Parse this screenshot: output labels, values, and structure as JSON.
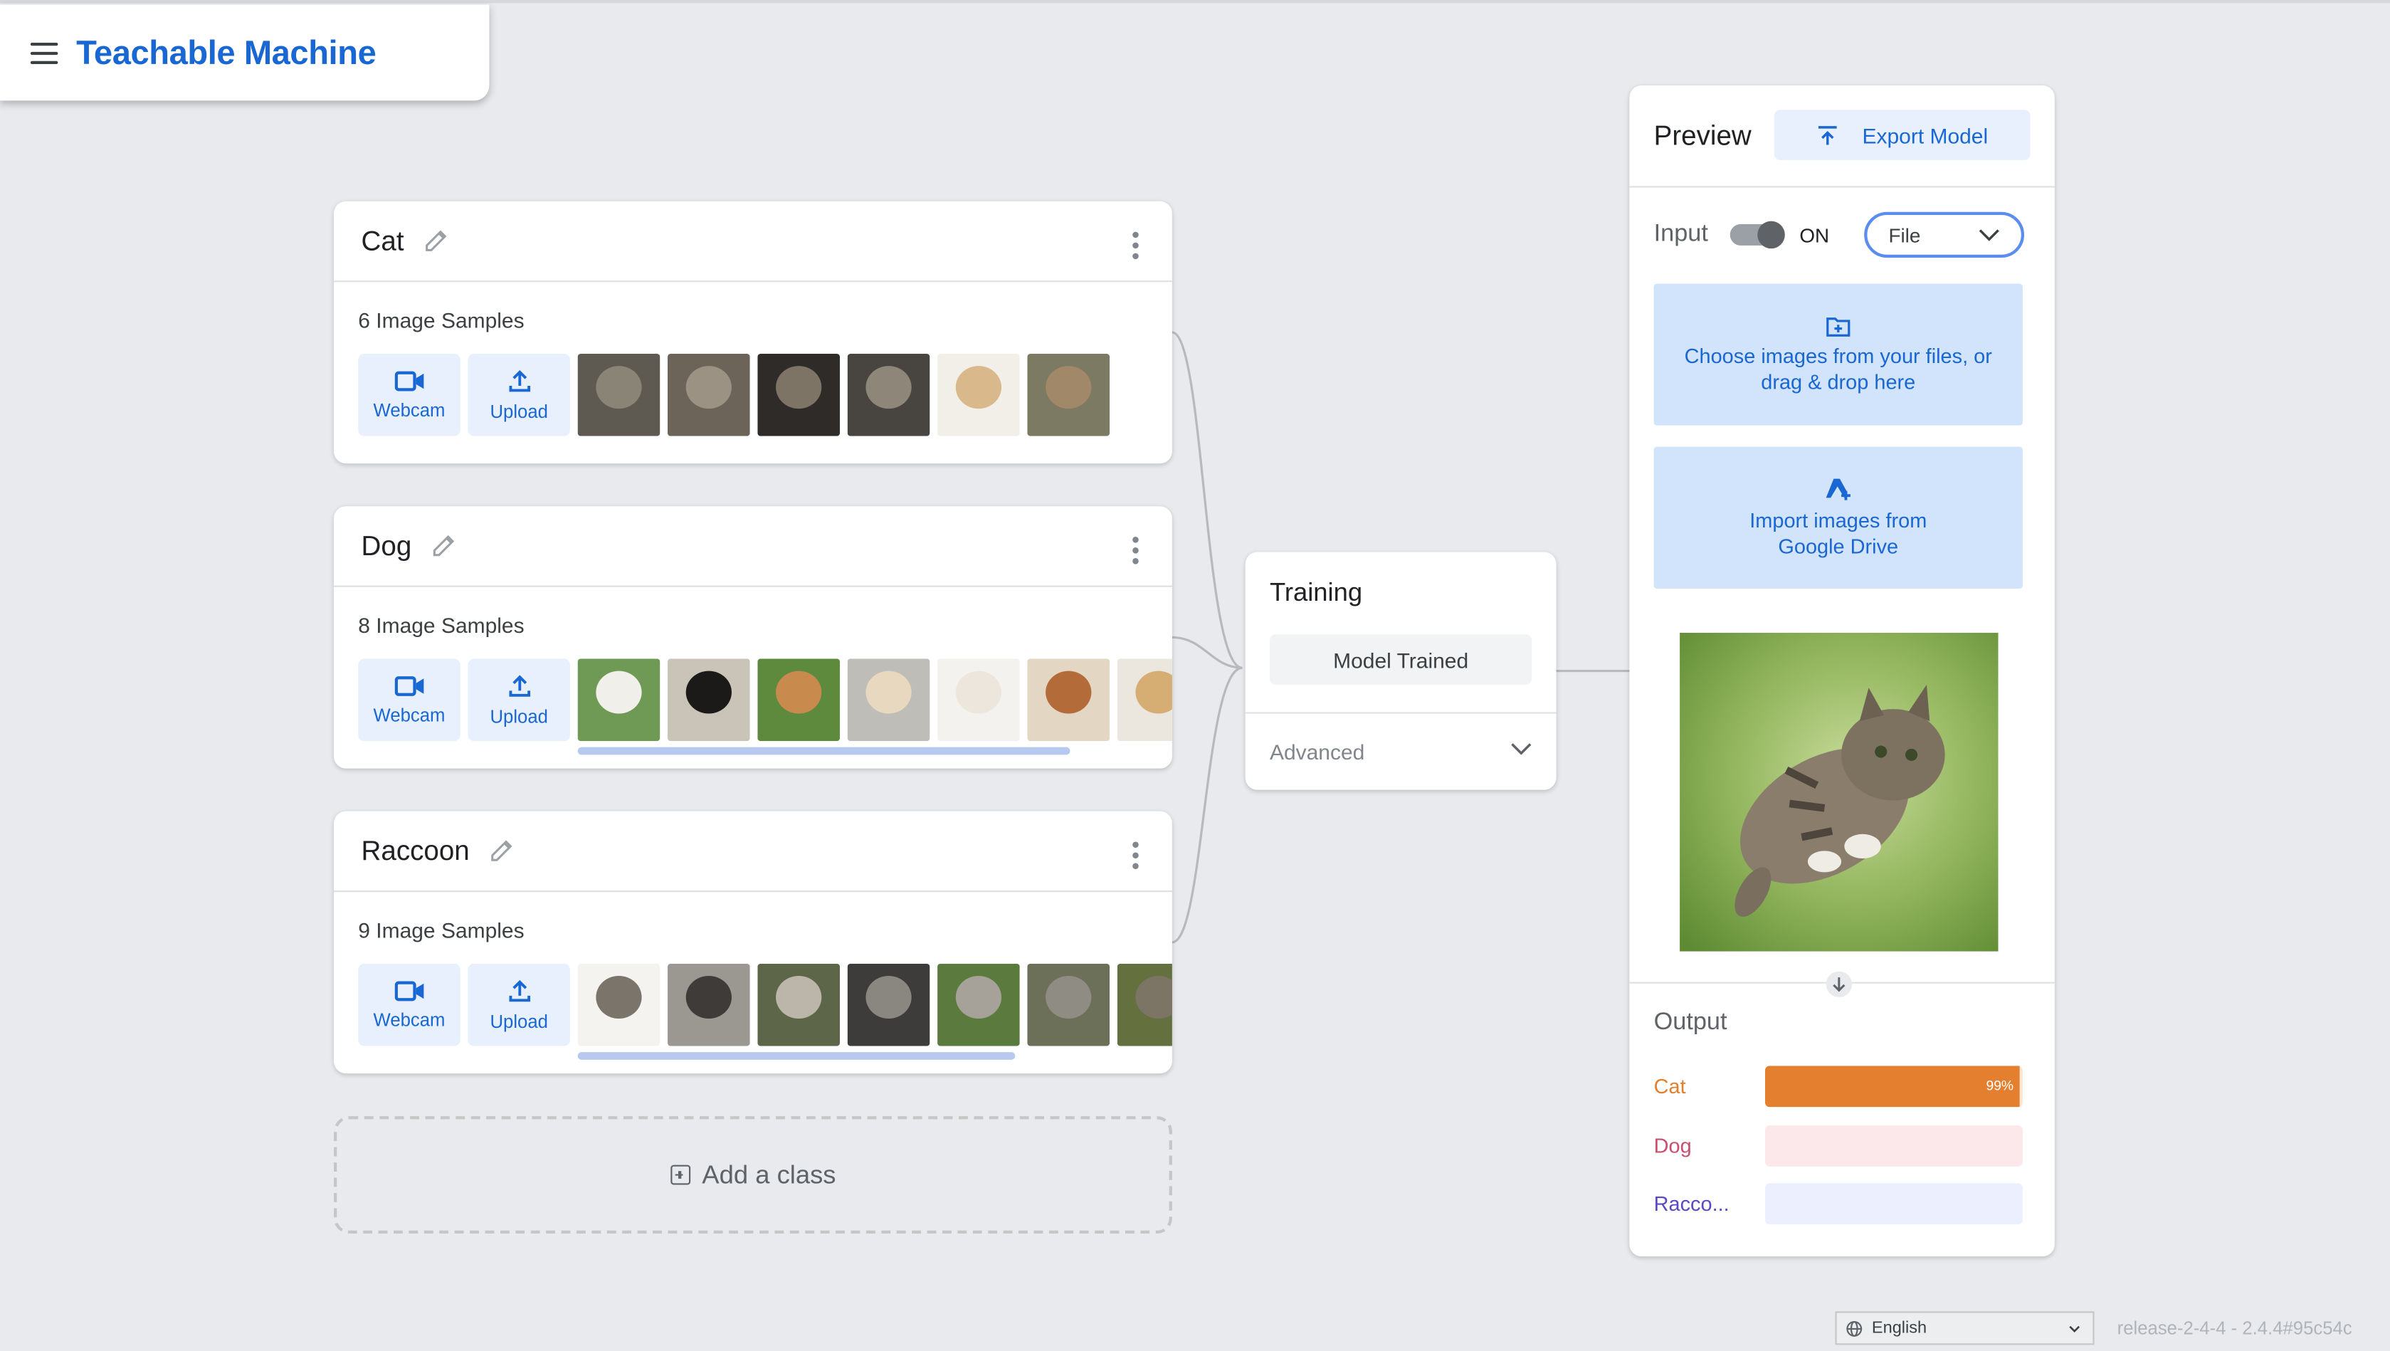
{
  "app": {
    "title": "Teachable Machine"
  },
  "classes": [
    {
      "name": "Cat",
      "samples_label": "6 Image Samples",
      "webcam_label": "Webcam",
      "upload_label": "Upload"
    },
    {
      "name": "Dog",
      "samples_label": "8 Image Samples",
      "webcam_label": "Webcam",
      "upload_label": "Upload"
    },
    {
      "name": "Raccoon",
      "samples_label": "9 Image Samples",
      "webcam_label": "Webcam",
      "upload_label": "Upload"
    }
  ],
  "add_class": {
    "label": "Add a class"
  },
  "training": {
    "title": "Training",
    "status_button": "Model Trained",
    "advanced_label": "Advanced"
  },
  "preview": {
    "title": "Preview",
    "export_label": "Export Model",
    "input_label": "Input",
    "toggle_state": "ON",
    "input_source": "File",
    "file_drop_text": "Choose images from your files, or drag & drop here",
    "drive_text": "Import images from Google Drive",
    "output_title": "Output",
    "outputs": [
      {
        "label": "Cat",
        "percent_text": "99%",
        "value": 0.99,
        "color": "#e37f2e",
        "track": "#fbe6d3"
      },
      {
        "label": "Dog",
        "percent_text": "",
        "value": 0.0,
        "color": "#c94f6d",
        "track": "#fce8ea"
      },
      {
        "label": "Racco...",
        "percent_text": "",
        "value": 0.0,
        "color": "#5b48c4",
        "track": "#eceffd"
      }
    ]
  },
  "footer": {
    "language": "English",
    "release": "release-2-4-4 - 2.4.4#95c54c"
  },
  "colors": {
    "accent": "#1967d2",
    "background": "#e8eaed",
    "tile": "#e8f0fe",
    "drop_zone": "#d2e3fc"
  }
}
